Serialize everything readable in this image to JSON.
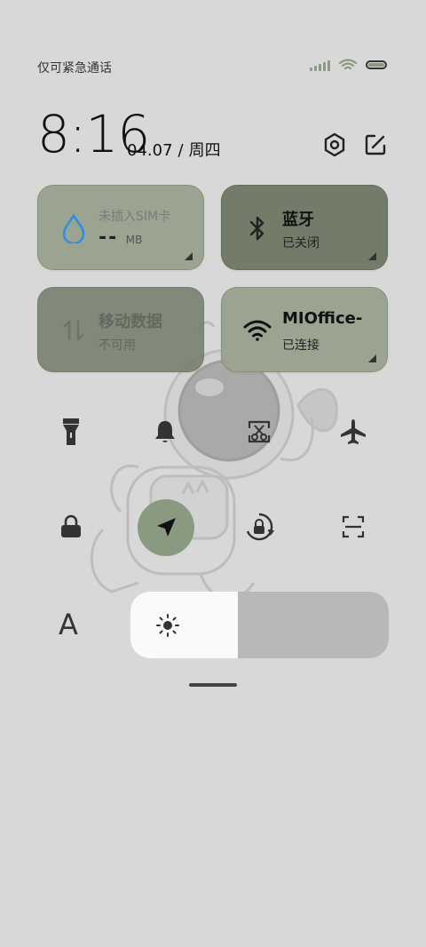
{
  "status_bar": {
    "text": "仅可紧急通话",
    "signal_icon": "signal-bars-icon",
    "wifi_icon": "wifi-icon",
    "battery_icon": "battery-icon",
    "accent_color": "#8a9a80"
  },
  "clock": {
    "time": "8:16",
    "date": "04.07",
    "separator": "/",
    "weekday": "周四"
  },
  "header_icons": [
    "settings-icon",
    "edit-icon"
  ],
  "tiles": {
    "sim": {
      "title": "未插入SIM卡",
      "value": "--",
      "unit": "MB",
      "icon": "water-drop-icon"
    },
    "bluetooth": {
      "title": "蓝牙",
      "status": "已关闭",
      "icon": "bluetooth-icon"
    },
    "mobile_data": {
      "title": "移动数据",
      "status": "不可用",
      "icon": "data-arrows-icon"
    },
    "wifi": {
      "title": "MIOffice-",
      "status": "已连接",
      "icon": "wifi-icon"
    }
  },
  "toggles_row1": [
    "flashlight-icon",
    "bell-icon",
    "screenshot-icon",
    "airplane-icon"
  ],
  "toggles_row2": [
    "lock-icon",
    "location-icon",
    "rotation-lock-icon",
    "scan-icon"
  ],
  "brightness": {
    "level": 0.415,
    "icon": "sun-icon"
  },
  "font_label": "A"
}
